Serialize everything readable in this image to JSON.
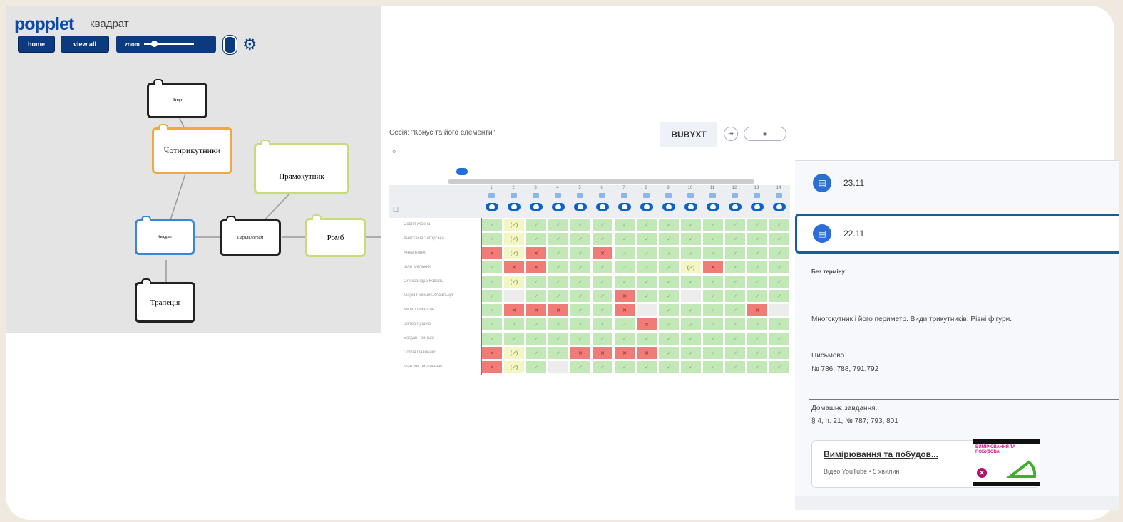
{
  "popplet": {
    "logo": "popplet",
    "title": "квадрат",
    "home_label": "home",
    "viewall_label": "view all",
    "zoom_label": "zoom",
    "nodes": {
      "vydy": "Види",
      "chotyrykutnyky": "Чотирикутники",
      "priamokutnyk": "Прямокутник",
      "kvadrat": "Квадрат",
      "paralelohram": "Паралелограм",
      "romb": "Ромб",
      "trapetsiia": "Трапеція"
    }
  },
  "session": {
    "title": "Сесія: \"Конус та його елементи\"",
    "code": "BUBYXT",
    "rows": [
      {
        "name": "Софія Жовна",
        "cells": [
          "ok",
          "part",
          "ok",
          "ok",
          "ok",
          "ok",
          "ok",
          "ok",
          "ok",
          "ok",
          "ok",
          "ok",
          "ok",
          "ok"
        ]
      },
      {
        "name": "Анастасія Загорська",
        "cells": [
          "ok",
          "part",
          "ok",
          "ok",
          "ok",
          "ok",
          "ok",
          "ok",
          "ok",
          "ok",
          "ok",
          "ok",
          "ok",
          "ok"
        ]
      },
      {
        "name": "Анна Бойко",
        "cells": [
          "bad",
          "part",
          "bad",
          "ok",
          "ok",
          "bad",
          "ok",
          "ok",
          "ok",
          "ok",
          "ok",
          "ok",
          "ok",
          "ok"
        ]
      },
      {
        "name": "Ілля Мельник",
        "cells": [
          "ok",
          "bad",
          "bad",
          "ok",
          "ok",
          "ok",
          "ok",
          "ok",
          "ok",
          "part",
          "bad",
          "ok",
          "ok",
          "ok"
        ]
      },
      {
        "name": "Олександра Коваль",
        "cells": [
          "ok",
          "part",
          "ok",
          "ok",
          "ok",
          "ok",
          "ok",
          "ok",
          "ok",
          "ok",
          "ok",
          "ok",
          "ok",
          "ok"
        ]
      },
      {
        "name": "Марія Олійник-Ковальчук",
        "cells": [
          "ok",
          "empty",
          "ok",
          "ok",
          "ok",
          "ok",
          "bad",
          "ok",
          "ok",
          "empty",
          "ok",
          "ok",
          "ok",
          "ok"
        ]
      },
      {
        "name": "Кирило Мартин",
        "cells": [
          "ok",
          "bad",
          "bad",
          "bad",
          "ok",
          "ok",
          "bad",
          "empty",
          "ok",
          "ok",
          "ok",
          "ok",
          "bad",
          "empty"
        ]
      },
      {
        "name": "Віктор Кушнір",
        "cells": [
          "ok",
          "ok",
          "ok",
          "ok",
          "ok",
          "ok",
          "ok",
          "bad",
          "ok",
          "ok",
          "ok",
          "ok",
          "ok",
          "ok"
        ]
      },
      {
        "name": "Богдан Гринько",
        "cells": [
          "ok",
          "ok",
          "ok",
          "ok",
          "ok",
          "ok",
          "ok",
          "ok",
          "ok",
          "ok",
          "ok",
          "ok",
          "ok",
          "ok"
        ]
      },
      {
        "name": "Софія Павленко",
        "cells": [
          "bad",
          "part",
          "ok",
          "ok",
          "bad",
          "bad",
          "bad",
          "bad",
          "ok",
          "ok",
          "ok",
          "ok",
          "ok",
          "ok"
        ]
      },
      {
        "name": "Максим Литвиненко",
        "cells": [
          "bad",
          "part",
          "ok",
          "empty",
          "ok",
          "ok",
          "ok",
          "ok",
          "ok",
          "ok",
          "ok",
          "ok",
          "ok",
          "ok"
        ]
      }
    ],
    "symbols": {
      "ok": "✓",
      "bad": "✕",
      "part": "(✓)",
      "empty": ""
    }
  },
  "assignments": {
    "items": [
      {
        "label": "23.11"
      },
      {
        "label": "22.11"
      }
    ],
    "deadline": "Без терміну",
    "description": "Многокутник і його периметр. Види трикутників. Рівні фігури.",
    "written_label": "Письмово",
    "written_numbers": "№ 786, 788, 791,792",
    "homework_label": "Домашнє завдання.",
    "homework_value": "§ 4, п. 21, № 787; 793, 801",
    "video_title": "Вимірювання та побудов...",
    "video_sub": "Відео YouTube • 5 хвилин"
  },
  "colors": {
    "popplet_blue": "#0b3a7e",
    "orange_node": "#f0a940",
    "green_node": "#c6dc7a",
    "blue_node": "#3b86d4",
    "selected_border": "#155f96"
  }
}
